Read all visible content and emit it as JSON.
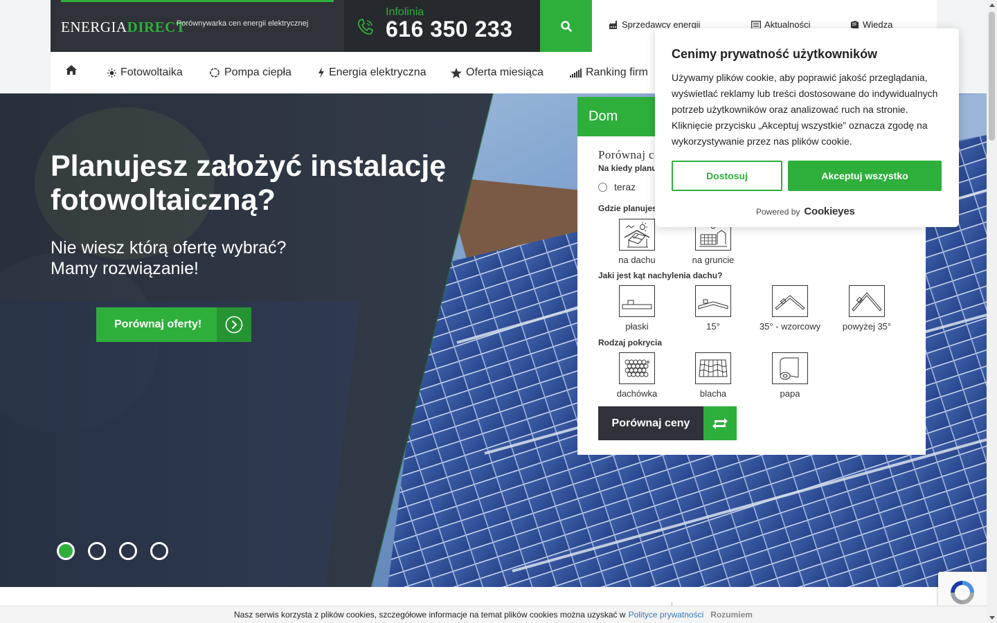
{
  "header": {
    "logo_part1": "ENERGIA",
    "logo_part2": "DIRECT",
    "tagline": "Porównywarka cen energii elektrycznej",
    "infoline_label": "Infolinia",
    "infoline_number": "616 350 233",
    "top_links": [
      "Sprzedawcy energii",
      "Aktualności",
      "Wiedza"
    ]
  },
  "nav": {
    "items": [
      "Fotowoltaika",
      "Pompa ciepła",
      "Energia elektryczna",
      "Oferta miesiąca",
      "Ranking firm"
    ]
  },
  "hero": {
    "title": "Planujesz założyć instalację fotowoltaiczną?",
    "subtitle_line1": "Nie wiesz którą ofertę wybrać?",
    "subtitle_line2": "Mamy rozwiązanie!",
    "cta": "Porównaj oferty!",
    "slide_count": 4,
    "active_slide": 1
  },
  "form": {
    "tab": "Dom",
    "title": "Porównaj c",
    "q1": "Na kiedy planuj",
    "q1_option": "teraz",
    "q2": "Gdzie planujesz",
    "q2_options": [
      "na dachu",
      "na gruncie"
    ],
    "q3": "Jaki jest kąt nachylenia dachu?",
    "q3_options": [
      "płaski",
      "15°",
      "35° - wzorcowy",
      "powyżej 35°"
    ],
    "q4": "Rodzaj pokrycia",
    "q4_options": [
      "dachówka",
      "blacha",
      "papa"
    ],
    "submit": "Porównaj ceny"
  },
  "cookie_modal": {
    "title": "Cenimy prywatność użytkowników",
    "text": "Używamy plików cookie, aby poprawić jakość przeglądania, wyświetlać reklamy lub treści dostosowane do indywidualnych potrzeb użytkowników oraz analizować ruch na stronie. Kliknięcie przycisku „Akceptuj wszystkie” oznacza zgodę na wykorzystywanie przez nas plików cookie.",
    "customize": "Dostosuj",
    "accept": "Akceptuj wszystko",
    "powered_by": "Powered by",
    "powered_brand": "Cookieyes"
  },
  "cookie_bar": {
    "text": "Nasz serwis korzysta z plików cookies, szczegółowe informacje na temat plików cookies można uzyskać w",
    "link": "Polityce prywatności",
    "ok": "Rozumiem"
  },
  "colors": {
    "accent": "#2eaf3c",
    "dark": "#2f3238",
    "darker": "#26292e"
  },
  "icons": [
    "home-icon",
    "sun-icon",
    "heat-pump-icon",
    "bolt-icon",
    "star-icon",
    "ranking-icon",
    "search-icon",
    "phone-icon",
    "factory-icon",
    "news-icon",
    "book-icon",
    "refresh-icon",
    "chevron-right-icon"
  ]
}
